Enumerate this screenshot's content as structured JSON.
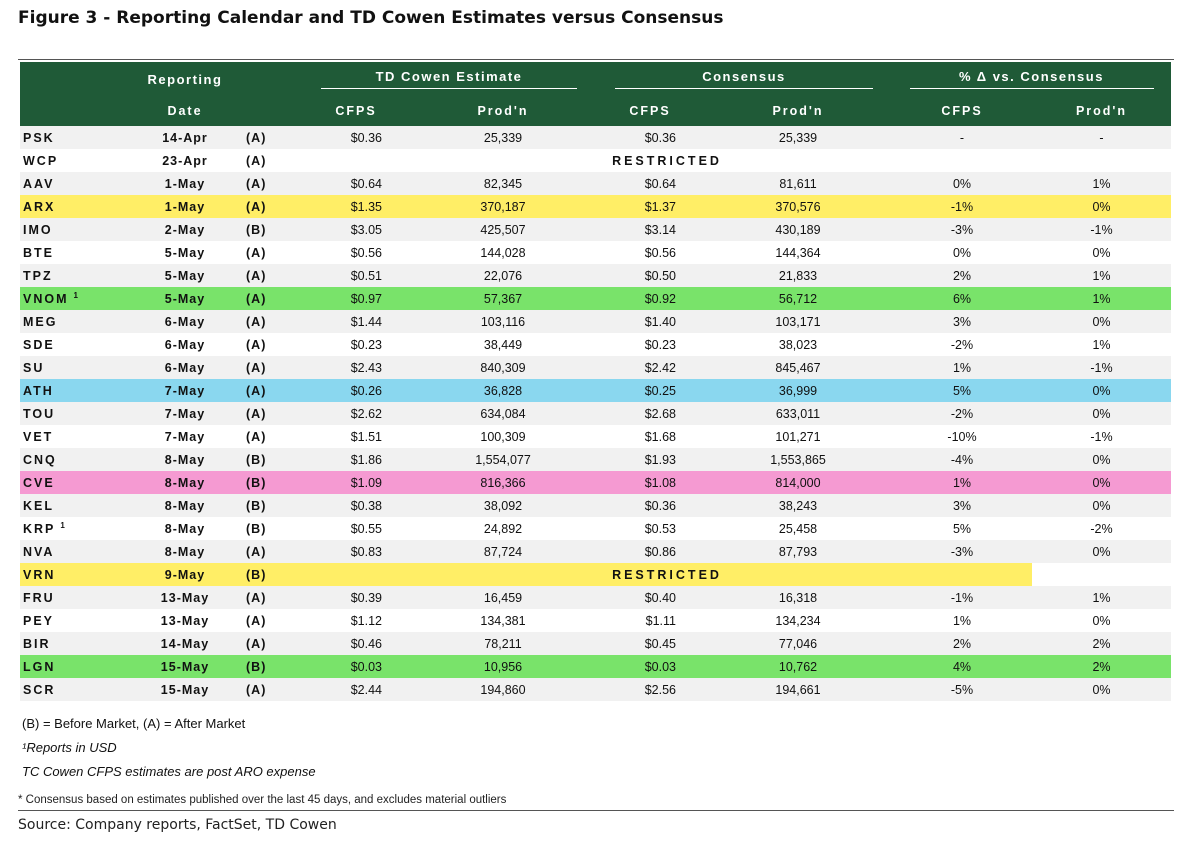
{
  "title": "Figure 3 - Reporting Calendar and TD Cowen Estimates versus Consensus",
  "header": {
    "reporting": "Reporting",
    "date": "Date",
    "td_estimate": "TD Cowen Estimate",
    "consensus": "Consensus",
    "pct_vs": "% Δ vs. Consensus",
    "cfps": "CFPS",
    "prodn": "Prod'n"
  },
  "rows": [
    {
      "ticker": "PSK",
      "sup": "",
      "date": "14-Apr",
      "ab": "(A)",
      "est_cfps": "$0.36",
      "est_prod": "25,339",
      "con_cfps": "$0.36",
      "con_prod": "25,339",
      "pct_cfps": "-",
      "pct_prod": "-",
      "highlight": ""
    },
    {
      "ticker": "WCP",
      "sup": "",
      "date": "23-Apr",
      "ab": "(A)",
      "restricted": "RESTRICTED",
      "highlight": ""
    },
    {
      "ticker": "AAV",
      "sup": "",
      "date": "1-May",
      "ab": "(A)",
      "est_cfps": "$0.64",
      "est_prod": "82,345",
      "con_cfps": "$0.64",
      "con_prod": "81,611",
      "pct_cfps": "0%",
      "pct_prod": "1%",
      "highlight": ""
    },
    {
      "ticker": "ARX",
      "sup": "",
      "date": "1-May",
      "ab": "(A)",
      "est_cfps": "$1.35",
      "est_prod": "370,187",
      "con_cfps": "$1.37",
      "con_prod": "370,576",
      "pct_cfps": "-1%",
      "pct_prod": "0%",
      "highlight": "yellow"
    },
    {
      "ticker": "IMO",
      "sup": "",
      "date": "2-May",
      "ab": "(B)",
      "est_cfps": "$3.05",
      "est_prod": "425,507",
      "con_cfps": "$3.14",
      "con_prod": "430,189",
      "pct_cfps": "-3%",
      "pct_prod": "-1%",
      "highlight": ""
    },
    {
      "ticker": "BTE",
      "sup": "",
      "date": "5-May",
      "ab": "(A)",
      "est_cfps": "$0.56",
      "est_prod": "144,028",
      "con_cfps": "$0.56",
      "con_prod": "144,364",
      "pct_cfps": "0%",
      "pct_prod": "0%",
      "highlight": ""
    },
    {
      "ticker": "TPZ",
      "sup": "",
      "date": "5-May",
      "ab": "(A)",
      "est_cfps": "$0.51",
      "est_prod": "22,076",
      "con_cfps": "$0.50",
      "con_prod": "21,833",
      "pct_cfps": "2%",
      "pct_prod": "1%",
      "highlight": ""
    },
    {
      "ticker": "VNOM",
      "sup": "1",
      "date": "5-May",
      "ab": "(A)",
      "est_cfps": "$0.97",
      "est_prod": "57,367",
      "con_cfps": "$0.92",
      "con_prod": "56,712",
      "pct_cfps": "6%",
      "pct_prod": "1%",
      "highlight": "green"
    },
    {
      "ticker": "MEG",
      "sup": "",
      "date": "6-May",
      "ab": "(A)",
      "est_cfps": "$1.44",
      "est_prod": "103,116",
      "con_cfps": "$1.40",
      "con_prod": "103,171",
      "pct_cfps": "3%",
      "pct_prod": "0%",
      "highlight": ""
    },
    {
      "ticker": "SDE",
      "sup": "",
      "date": "6-May",
      "ab": "(A)",
      "est_cfps": "$0.23",
      "est_prod": "38,449",
      "con_cfps": "$0.23",
      "con_prod": "38,023",
      "pct_cfps": "-2%",
      "pct_prod": "1%",
      "highlight": ""
    },
    {
      "ticker": "SU",
      "sup": "",
      "date": "6-May",
      "ab": "(A)",
      "est_cfps": "$2.43",
      "est_prod": "840,309",
      "con_cfps": "$2.42",
      "con_prod": "845,467",
      "pct_cfps": "1%",
      "pct_prod": "-1%",
      "highlight": ""
    },
    {
      "ticker": "ATH",
      "sup": "",
      "date": "7-May",
      "ab": "(A)",
      "est_cfps": "$0.26",
      "est_prod": "36,828",
      "con_cfps": "$0.25",
      "con_prod": "36,999",
      "pct_cfps": "5%",
      "pct_prod": "0%",
      "highlight": "blue"
    },
    {
      "ticker": "TOU",
      "sup": "",
      "date": "7-May",
      "ab": "(A)",
      "est_cfps": "$2.62",
      "est_prod": "634,084",
      "con_cfps": "$2.68",
      "con_prod": "633,011",
      "pct_cfps": "-2%",
      "pct_prod": "0%",
      "highlight": ""
    },
    {
      "ticker": "VET",
      "sup": "",
      "date": "7-May",
      "ab": "(A)",
      "est_cfps": "$1.51",
      "est_prod": "100,309",
      "con_cfps": "$1.68",
      "con_prod": "101,271",
      "pct_cfps": "-10%",
      "pct_prod": "-1%",
      "highlight": ""
    },
    {
      "ticker": "CNQ",
      "sup": "",
      "date": "8-May",
      "ab": "(B)",
      "est_cfps": "$1.86",
      "est_prod": "1,554,077",
      "con_cfps": "$1.93",
      "con_prod": "1,553,865",
      "pct_cfps": "-4%",
      "pct_prod": "0%",
      "highlight": ""
    },
    {
      "ticker": "CVE",
      "sup": "",
      "date": "8-May",
      "ab": "(B)",
      "est_cfps": "$1.09",
      "est_prod": "816,366",
      "con_cfps": "$1.08",
      "con_prod": "814,000",
      "pct_cfps": "1%",
      "pct_prod": "0%",
      "highlight": "pink"
    },
    {
      "ticker": "KEL",
      "sup": "",
      "date": "8-May",
      "ab": "(B)",
      "est_cfps": "$0.38",
      "est_prod": "38,092",
      "con_cfps": "$0.36",
      "con_prod": "38,243",
      "pct_cfps": "3%",
      "pct_prod": "0%",
      "highlight": ""
    },
    {
      "ticker": "KRP",
      "sup": "1",
      "date": "8-May",
      "ab": "(B)",
      "est_cfps": "$0.55",
      "est_prod": "24,892",
      "con_cfps": "$0.53",
      "con_prod": "25,458",
      "pct_cfps": "5%",
      "pct_prod": "-2%",
      "highlight": ""
    },
    {
      "ticker": "NVA",
      "sup": "",
      "date": "8-May",
      "ab": "(A)",
      "est_cfps": "$0.83",
      "est_prod": "87,724",
      "con_cfps": "$0.86",
      "con_prod": "87,793",
      "pct_cfps": "-3%",
      "pct_prod": "0%",
      "highlight": ""
    },
    {
      "ticker": "VRN",
      "sup": "",
      "date": "9-May",
      "ab": "(B)",
      "restricted": "RESTRICTED",
      "highlight": "yellow"
    },
    {
      "ticker": "FRU",
      "sup": "",
      "date": "13-May",
      "ab": "(A)",
      "est_cfps": "$0.39",
      "est_prod": "16,459",
      "con_cfps": "$0.40",
      "con_prod": "16,318",
      "pct_cfps": "-1%",
      "pct_prod": "1%",
      "highlight": ""
    },
    {
      "ticker": "PEY",
      "sup": "",
      "date": "13-May",
      "ab": "(A)",
      "est_cfps": "$1.12",
      "est_prod": "134,381",
      "con_cfps": "$1.11",
      "con_prod": "134,234",
      "pct_cfps": "1%",
      "pct_prod": "0%",
      "highlight": ""
    },
    {
      "ticker": "BIR",
      "sup": "",
      "date": "14-May",
      "ab": "(A)",
      "est_cfps": "$0.46",
      "est_prod": "78,211",
      "con_cfps": "$0.45",
      "con_prod": "77,046",
      "pct_cfps": "2%",
      "pct_prod": "2%",
      "highlight": ""
    },
    {
      "ticker": "LGN",
      "sup": "",
      "date": "15-May",
      "ab": "(B)",
      "est_cfps": "$0.03",
      "est_prod": "10,956",
      "con_cfps": "$0.03",
      "con_prod": "10,762",
      "pct_cfps": "4%",
      "pct_prod": "2%",
      "highlight": "green"
    },
    {
      "ticker": "SCR",
      "sup": "",
      "date": "15-May",
      "ab": "(A)",
      "est_cfps": "$2.44",
      "est_prod": "194,860",
      "con_cfps": "$2.56",
      "con_prod": "194,661",
      "pct_cfps": "-5%",
      "pct_prod": "0%",
      "highlight": ""
    }
  ],
  "notes": {
    "legend": "(B) = Before Market, (A) = After Market",
    "usd": "¹Reports in USD",
    "aro": "TC Cowen CFPS estimates are post ARO expense"
  },
  "footnote": "* Consensus based on estimates published over the last 45 days, and excludes material outliers",
  "source": "Source: Company reports, FactSet, TD Cowen",
  "colors": {
    "header_green": "#1f5a37",
    "yellow": "#ffee66",
    "green": "#79e36a",
    "blue": "#8ad7ef",
    "pink": "#f59ad2"
  }
}
